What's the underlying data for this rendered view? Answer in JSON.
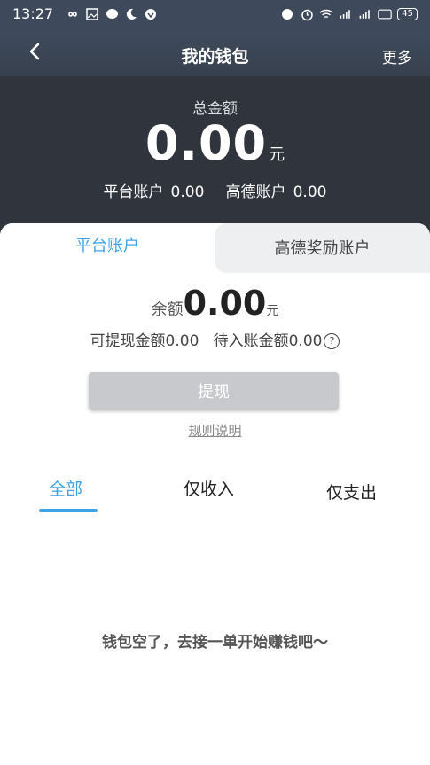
{
  "statusbar": {
    "time": "13:27",
    "left_icons": [
      "infinity-icon",
      "image-icon",
      "chat-icon",
      "moon-icon",
      "shield-icon"
    ],
    "right_icons": [
      "nfc-icon",
      "alarm-icon",
      "wifi-icon",
      "signal-4g-icon",
      "signal-4g-icon",
      "hd-icon"
    ],
    "battery": "45"
  },
  "header": {
    "title": "我的钱包",
    "more_label": "更多"
  },
  "summary": {
    "total_label": "总金额",
    "total_amount": "0.00",
    "unit": "元",
    "platform_label": "平台账户",
    "platform_amount": "0.00",
    "gaode_label": "高德账户",
    "gaode_amount": "0.00"
  },
  "tabs": {
    "platform": "平台账户",
    "gaode_reward": "高德奖励账户"
  },
  "balance": {
    "label": "余额",
    "amount": "0.00",
    "unit": "元",
    "withdrawable_label": "可提现金额",
    "withdrawable_amount": "0.00",
    "pending_label": "待入账金额",
    "pending_amount": "0.00",
    "help_symbol": "?"
  },
  "actions": {
    "withdraw_label": "提现",
    "rules_label": "规则说明"
  },
  "filters": {
    "all": "全部",
    "income": "仅收入",
    "expense": "仅支出"
  },
  "empty_text": "钱包空了，去接一单开始赚钱吧～",
  "colors": {
    "accent": "#3ea3e6",
    "header_bg": "#3e4a5c",
    "summary_bg": "#30343d"
  }
}
